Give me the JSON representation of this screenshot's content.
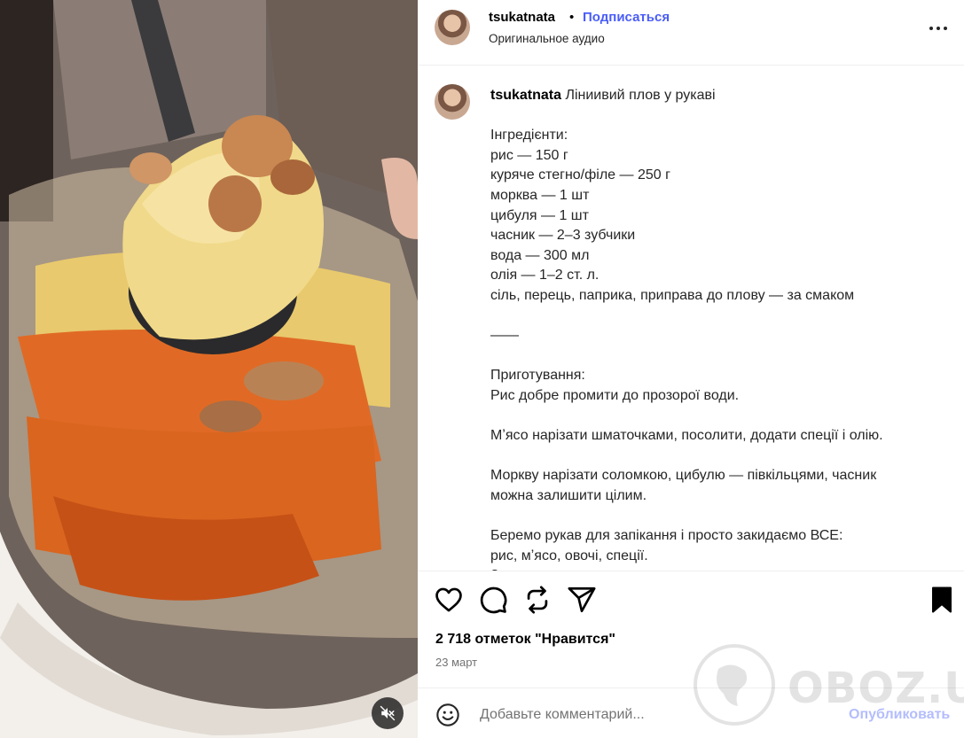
{
  "header": {
    "username": "tsukatnata",
    "separator": "•",
    "follow_label": "Подписаться",
    "audio_label": "Оригинальное аудио",
    "more_icon": "more-horizontal-icon"
  },
  "caption": {
    "username": "tsukatnata",
    "text": " Ліниивий плов у рукаві\n\nІнгредієнти:\nрис — 150 г\nкуряче стегно/філе — 250 г\nморква — 1 шт\nцибуля — 1 шт\nчасник — 2–3 зубчики\nвода — 300 мл\nолія — 1–2 ст. л.\nсіль, перець, паприка, приправа до плову — за смаком\n\n——\n\nПриготування:\nРис добре промити до прозорої води.\n\nМʼясо нарізати шматочками, посолити, додати спеції і олію.\n\nМоркву нарізати соломкою, цибулю — півкільцями, часник\nможна залишити цілим.\n\nБеремо рукав для запікання і просто закидаємо ВСЕ:\nрис, мʼясо, овочі, спеції.\nЗ"
  },
  "actions": {
    "like_icon": "heart-icon",
    "comment_icon": "comment-icon",
    "repost_icon": "repost-icon",
    "share_icon": "send-icon",
    "save_icon": "bookmark-icon"
  },
  "stats": {
    "likes": "2 718 отметок \"Нравится\"",
    "date": "23 март"
  },
  "comment": {
    "placeholder": "Добавьте комментарий...",
    "publish_label": "Опубликовать",
    "emoji_icon": "emoji-icon"
  },
  "media": {
    "mute_icon": "speaker-muted-icon"
  },
  "watermark": {
    "text": "OBOZ.UA"
  },
  "colors": {
    "link_blue": "#4a5df9",
    "publish_disabled": "#b3bdfd",
    "muted_text": "#737373"
  }
}
